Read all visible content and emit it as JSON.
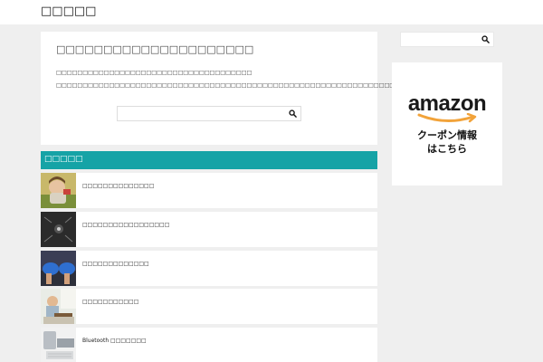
{
  "header": {
    "site_title": "□□□□□"
  },
  "main": {
    "heading": "□□□□□□□□□□□□□□□□□□□□□",
    "text_line1": "□□□□□□□□□□□□□□□□□□□□□□□□□□□□□□□□□□□□□",
    "text_line2": "□□□□□□□□□□□□□□□□□□□□□□□□□□□□□□□□□□□□□□□□□□□□□□□□□□□□□□□□□□□□□□□□□□□□□□□□□□",
    "search": {
      "value": "",
      "placeholder": ""
    }
  },
  "section": {
    "title": "□□□□□"
  },
  "posts": [
    {
      "title": "□□□□□□□□□□□□□□"
    },
    {
      "title": "□□□□□□□□□□□□□□□□□"
    },
    {
      "title": "□□□□□□□□□□□□□"
    },
    {
      "title": "□□□□□□□□□□□"
    },
    {
      "title": "Bluetooth □□□□□□□"
    }
  ],
  "sidebar": {
    "search": {
      "value": "",
      "placeholder": ""
    },
    "banner": {
      "brand": "amazon",
      "line1": "クーポン情報",
      "line2": "はこちら"
    }
  },
  "colors": {
    "accent": "#16a3a6",
    "amazon_orange": "#f2a33a"
  },
  "icons": {
    "search": "search-icon"
  }
}
